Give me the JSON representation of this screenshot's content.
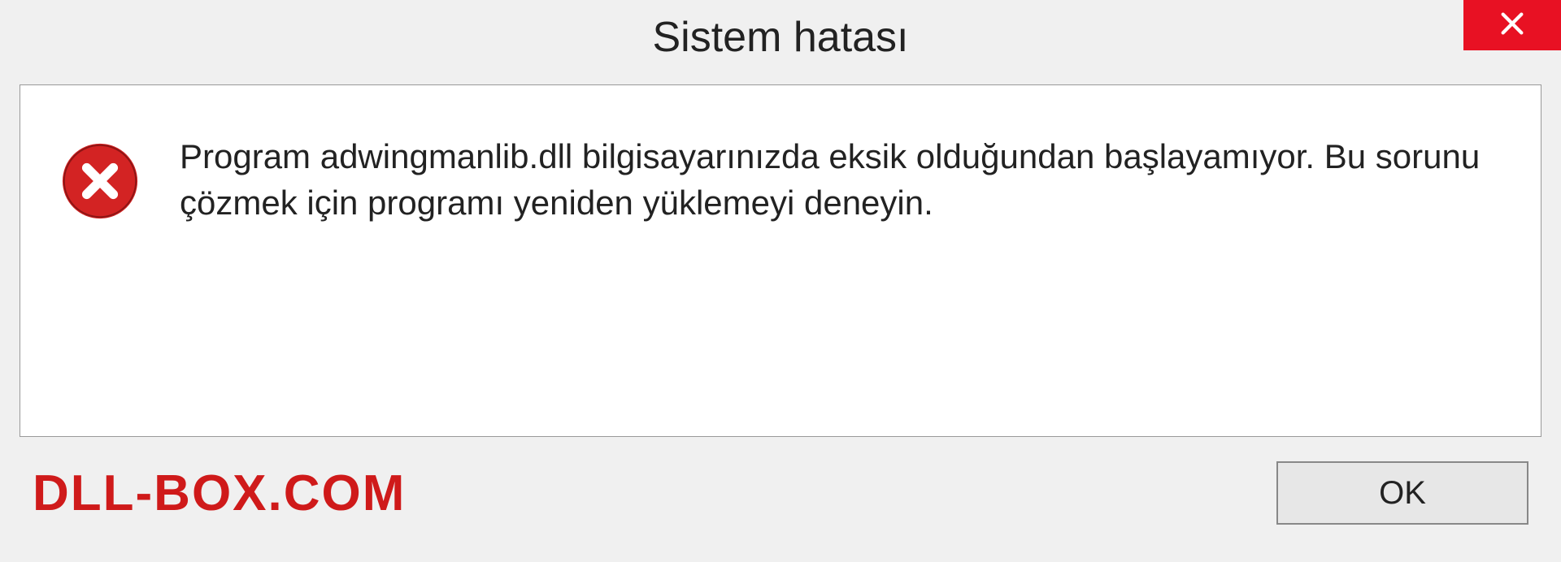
{
  "dialog": {
    "title": "Sistem hatası",
    "message": "Program adwingmanlib.dll bilgisayarınızda eksik olduğundan başlayamıyor. Bu sorunu çözmek için programı yeniden yüklemeyi deneyin.",
    "ok_label": "OK"
  },
  "watermark": "DLL-BOX.COM"
}
